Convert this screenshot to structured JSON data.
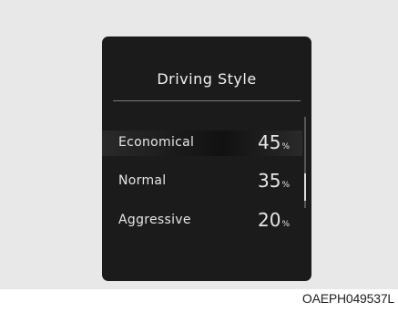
{
  "screen": {
    "title": "Driving Style",
    "items": [
      {
        "label": "Economical",
        "value": "45",
        "unit": "%",
        "selected": true
      },
      {
        "label": "Normal",
        "value": "35",
        "unit": "%",
        "selected": false
      },
      {
        "label": "Aggressive",
        "value": "20",
        "unit": "%",
        "selected": false
      }
    ]
  },
  "caption": "OAEPH049537L",
  "colors": {
    "panel_background": "#1b1b1b",
    "text": "#e6e6e6",
    "frame_background": "#e8e8e8"
  }
}
